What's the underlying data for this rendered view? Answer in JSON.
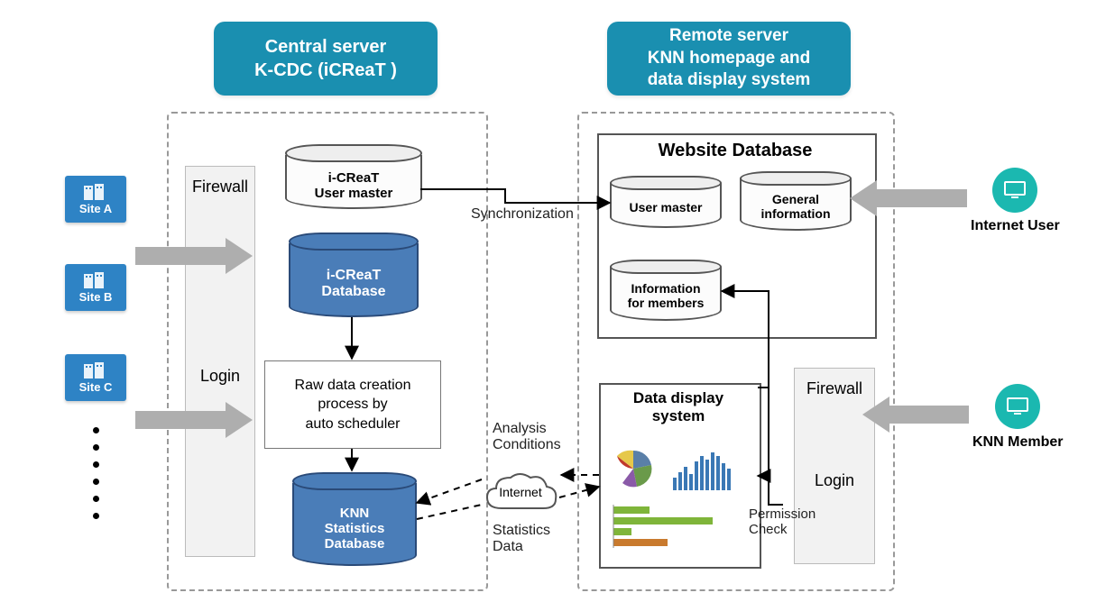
{
  "headers": {
    "central": "Central server\nK-CDC (iCReaT )",
    "remote": "Remote server\nKNN homepage and\ndata display system"
  },
  "sites": {
    "a": "Site A",
    "b": "Site B",
    "c": "Site C"
  },
  "firewall": {
    "title": "Firewall",
    "login": "Login"
  },
  "central": {
    "usermaster": "i-CReaT\nUser master",
    "icreatdb": "i-CReaT\nDatabase",
    "process": "Raw data creation\nprocess by\nauto scheduler",
    "knnstats": "KNN\nStatistics\nDatabase"
  },
  "mid": {
    "sync": "Synchronization",
    "analysis": "Analysis\nConditions",
    "internet": "Internet",
    "statsdata": "Statistics\nData"
  },
  "remote": {
    "website_title": "Website  Database",
    "usermaster": "User master",
    "general": "General\ninformation",
    "members": "Information\nfor members",
    "dds": "Data display\nsystem",
    "permission": "Permission\nCheck"
  },
  "users": {
    "internet": "Internet User",
    "member": "KNN Member"
  }
}
